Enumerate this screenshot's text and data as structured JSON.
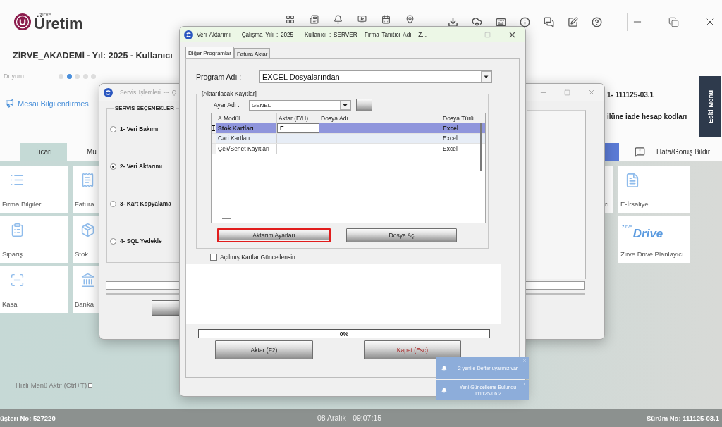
{
  "app": {
    "logo": {
      "tagline": "zirve",
      "name": "Üretim"
    },
    "company_line": "ZİRVE_AKADEMİ - Yıl: 2025 - Kullanıcı",
    "announcement": {
      "label": "Duyuru",
      "dots": [
        {
          "selected": false
        },
        {
          "selected": true
        },
        {
          "selected": false
        },
        {
          "selected": false
        },
        {
          "selected": false
        }
      ]
    },
    "notice": "Mesai Bilgilendirmes",
    "version_line": "1- 111125-03.1",
    "info_line": "ilüne iade hesap kodları",
    "side_tab": "Eski Menü",
    "tabs": [
      {
        "label": "Ticari",
        "selected": true
      },
      {
        "label": "Mu",
        "selected": false
      }
    ],
    "feedback_link": "Hata/Görüş Bildir",
    "tiles": [
      {
        "label": "Firma Bilgileri"
      },
      {
        "label": "Fatura"
      },
      {
        "label": "Sipariş"
      },
      {
        "label": "Stok"
      },
      {
        "label": "Kasa"
      },
      {
        "label": "Banka"
      }
    ],
    "right_tiles": [
      {
        "kind": "partial",
        "label": "ri"
      },
      {
        "kind": "icon",
        "label": "E-İrsaliye"
      },
      {
        "kind": "logo",
        "logo_tagline": "zirve",
        "logo_name": "Drive",
        "label": "Zirve Drive Planlayıcı"
      }
    ],
    "quick_menu": {
      "label": "Hızlı Menü Aktif (Ctrl+T)",
      "checked": false
    },
    "status_bar": {
      "customer": "üşteri No: 527220",
      "datetime": "08 Aralık - 09:07:15",
      "version": "Sürüm No: 111125-03.1"
    }
  },
  "service_window": {
    "title": "Servis İşlemleri --- Ç",
    "group_title": "SERVİS SEÇENEKLER",
    "options": [
      {
        "label": "1- Veri Bakımı",
        "selected": false
      },
      {
        "label": "2- Veri Aktarımı",
        "selected": true
      },
      {
        "label": "3- Kart Kopyalama",
        "selected": false
      },
      {
        "label": "4- SQL Yedekle",
        "selected": false
      }
    ],
    "progress": {
      "level": 0
    }
  },
  "transfer_window": {
    "title": "Veri Aktarımı --- Çalışma Yılı : 2025 --- Kullanıcı : SERVER - Firma Tanıtıcı Adı : Z...",
    "tabs": [
      {
        "label": "Diğer Programlar",
        "selected": true
      },
      {
        "label": "Fatura Aktar",
        "selected": false
      }
    ],
    "program": {
      "label": "Program Adı :",
      "value": "EXCEL Dosyalarından"
    },
    "group_title": "[Aktarılacak Kayıtlar]",
    "setting": {
      "label": "Ayar Adı :",
      "value": "GENEL"
    },
    "table": {
      "columns": [
        "A.Modül",
        "Aktar (E/H)",
        "Dosya Adı",
        "Dosya Türü"
      ],
      "rows": [
        {
          "module": "Stok Kartları",
          "transfer": "E",
          "file_type": "Excel",
          "selected": true
        },
        {
          "module": "Cari Kartları",
          "file_type": "Excel",
          "selected": false
        },
        {
          "module": "Çek/Senet Kayıtları",
          "file_type": "Excel",
          "selected": false
        }
      ]
    },
    "buttons": [
      {
        "label": "Aktarım Ayarları",
        "highlighted": true
      },
      {
        "label": "Dosya Aç",
        "highlighted": false
      }
    ],
    "update_checkbox": {
      "label": "Açılmış Kartlar Güncellensin",
      "checked": false
    },
    "progress": {
      "level": 0,
      "reading": "0%"
    },
    "actions": [
      {
        "label": "Aktar (F2)",
        "kind": "normal"
      },
      {
        "label": "Kapat (Esc)",
        "kind": "danger"
      }
    ]
  },
  "notifications": [
    {
      "lines": [
        "2 yeni e-Defter uyarınız var"
      ]
    },
    {
      "lines": [
        "Yeni Güncelleme Bulundu",
        "111125-06.2"
      ]
    }
  ]
}
